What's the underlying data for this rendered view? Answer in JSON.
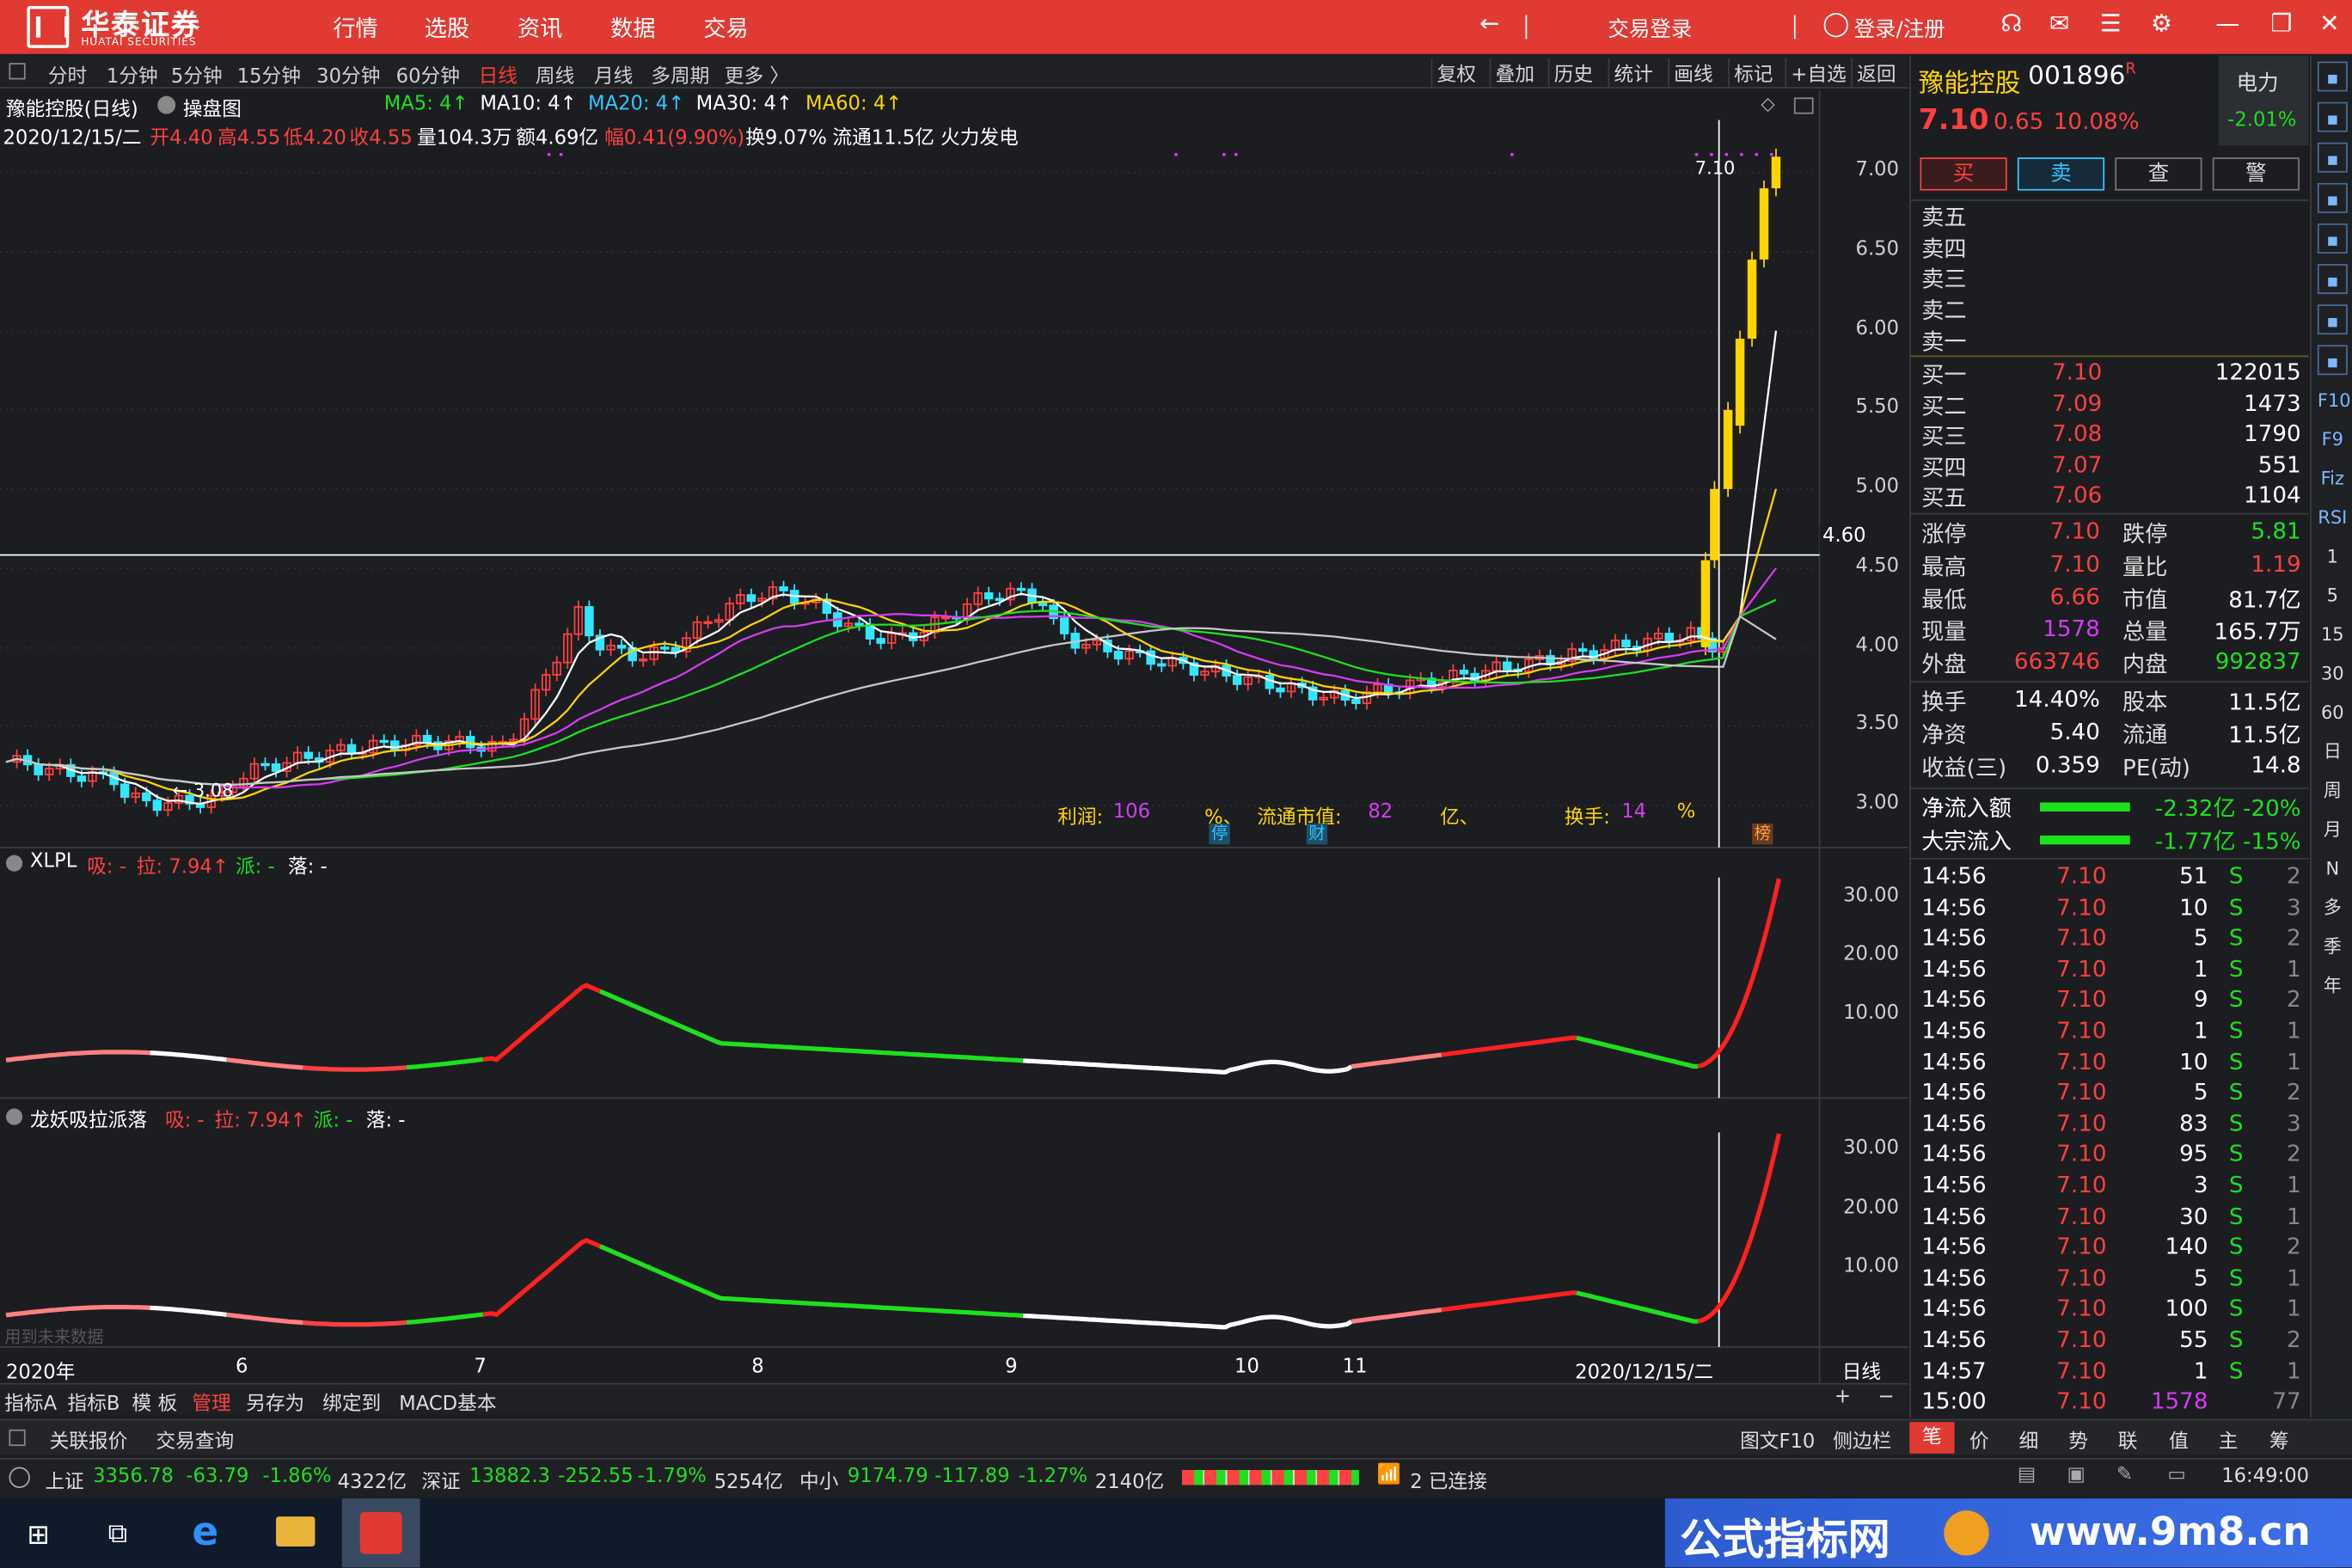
{
  "app": {
    "logo_name": "华泰证券",
    "logo_sub": "HUATAI SECURITIES"
  },
  "topnav": [
    "行情",
    "选股",
    "资讯",
    "数据",
    "交易"
  ],
  "titlebar": {
    "trade_login": "交易登录",
    "login_register": "登录/注册"
  },
  "periods": [
    "分时",
    "1分钟",
    "5分钟",
    "15分钟",
    "30分钟",
    "60分钟",
    "日线",
    "周线",
    "月线",
    "多周期",
    "更多 〉"
  ],
  "right_tools": [
    "复权",
    "叠加",
    "历史",
    "统计",
    "画线",
    "标记",
    "+自选",
    "返回"
  ],
  "stock": {
    "name": "豫能控股",
    "code": "001896",
    "flag": "R",
    "price": "7.10",
    "change": "0.65",
    "pct": "10.08%",
    "sector": "电力",
    "sector_pct": "-2.01%"
  },
  "chart_header": {
    "title": "豫能控股(日线)",
    "mode": "操盘图",
    "ma5": "MA5: 4↑",
    "ma10": "MA10: 4↑",
    "ma20": "MA20: 4↑",
    "ma30": "MA30: 4↑",
    "ma60": "MA60: 4↑"
  },
  "day_info": {
    "date": "2020/12/15/二",
    "open": "开4.40",
    "high": "高4.55",
    "low": "低4.20",
    "close": "收4.55",
    "vol": "量104.3万",
    "amt": "额4.69亿",
    "amp": "幅0.41(9.90%)",
    "turn": "换9.07%",
    "flow": "流通11.5亿",
    "theme": "火力发电"
  },
  "price_axis": [
    "7.00",
    "6.50",
    "6.00",
    "5.50",
    "5.00",
    "4.50",
    "4.00",
    "3.50",
    "3.00"
  ],
  "crosshair": {
    "value": "4.60"
  },
  "annotations": {
    "max_label": "7.10",
    "min_label": "← 3.08",
    "profit": "利润:",
    "profit_val": "106",
    "pct1": "%、",
    "mktcap": "流通市值:",
    "mktcap_val": "82",
    "yi": "亿、",
    "turnover": "换手:",
    "turnover_val": "14",
    "pct2": "%",
    "tag1": "停",
    "tag2": "财",
    "tag3": "榜"
  },
  "ind1": {
    "name": "XLPL",
    "xi": "吸: -",
    "la": "拉: 7.94↑",
    "pai": "派: -",
    "luo": "落: -",
    "axis": [
      "30.00",
      "20.00",
      "10.00"
    ]
  },
  "ind2": {
    "name": "龙妖吸拉派落",
    "xi": "吸: -",
    "la": "拉: 7.94↑",
    "pai": "派: -",
    "luo": "落: -",
    "axis": [
      "30.00",
      "20.00",
      "10.00"
    ],
    "note": "用到未来数据"
  },
  "time_axis": [
    "2020年",
    "6",
    "7",
    "8",
    "9",
    "10",
    "11",
    "2020/12/15/二",
    "日线"
  ],
  "bottom_tabs": [
    "指标A",
    "指标B",
    "模 板",
    "管理",
    "另存为",
    "绑定到",
    "MACD基本"
  ],
  "bottom_tabs2": [
    "关联报价",
    "交易查询"
  ],
  "bottom_right": [
    "图文F10",
    "侧边栏"
  ],
  "trade_buttons": [
    "买",
    "卖",
    "查",
    "警"
  ],
  "sell_rows": [
    "卖五",
    "卖四",
    "卖三",
    "卖二",
    "卖一"
  ],
  "buy_rows": [
    {
      "label": "买一",
      "price": "7.10",
      "vol": "122015"
    },
    {
      "label": "买二",
      "price": "7.09",
      "vol": "1473"
    },
    {
      "label": "买三",
      "price": "7.08",
      "vol": "1790"
    },
    {
      "label": "买四",
      "price": "7.07",
      "vol": "551"
    },
    {
      "label": "买五",
      "price": "7.06",
      "vol": "1104"
    }
  ],
  "stats": [
    {
      "l1": "涨停",
      "v1": "7.10",
      "c1": "red",
      "l2": "跌停",
      "v2": "5.81",
      "c2": "green"
    },
    {
      "l1": "最高",
      "v1": "7.10",
      "c1": "red",
      "l2": "量比",
      "v2": "1.19",
      "c2": "red"
    },
    {
      "l1": "最低",
      "v1": "6.66",
      "c1": "red",
      "l2": "市值",
      "v2": "81.7亿",
      "c2": "white"
    },
    {
      "l1": "现量",
      "v1": "1578",
      "c1": "magenta",
      "l2": "总量",
      "v2": "165.7万",
      "c2": "white"
    },
    {
      "l1": "外盘",
      "v1": "663746",
      "c1": "red",
      "l2": "内盘",
      "v2": "992837",
      "c2": "green"
    }
  ],
  "stats2": [
    {
      "l1": "换手",
      "v1": "14.40%",
      "l2": "股本",
      "v2": "11.5亿"
    },
    {
      "l1": "净资",
      "v1": "5.40",
      "l2": "流通",
      "v2": "11.5亿"
    },
    {
      "l1": "收益(三)",
      "v1": "0.359",
      "l2": "PE(动)",
      "v2": "14.8"
    }
  ],
  "flows": [
    {
      "label": "净流入额",
      "val": "-2.32亿 -20%"
    },
    {
      "label": "大宗流入",
      "val": "-1.77亿 -15%"
    }
  ],
  "ticks": [
    {
      "t": "14:56",
      "p": "7.10",
      "v": "51",
      "s": "S",
      "n": "2"
    },
    {
      "t": "14:56",
      "p": "7.10",
      "v": "10",
      "s": "S",
      "n": "3"
    },
    {
      "t": "14:56",
      "p": "7.10",
      "v": "5",
      "s": "S",
      "n": "2"
    },
    {
      "t": "14:56",
      "p": "7.10",
      "v": "1",
      "s": "S",
      "n": "1"
    },
    {
      "t": "14:56",
      "p": "7.10",
      "v": "9",
      "s": "S",
      "n": "2"
    },
    {
      "t": "14:56",
      "p": "7.10",
      "v": "1",
      "s": "S",
      "n": "1"
    },
    {
      "t": "14:56",
      "p": "7.10",
      "v": "10",
      "s": "S",
      "n": "1"
    },
    {
      "t": "14:56",
      "p": "7.10",
      "v": "5",
      "s": "S",
      "n": "2"
    },
    {
      "t": "14:56",
      "p": "7.10",
      "v": "83",
      "s": "S",
      "n": "3"
    },
    {
      "t": "14:56",
      "p": "7.10",
      "v": "95",
      "s": "S",
      "n": "2"
    },
    {
      "t": "14:56",
      "p": "7.10",
      "v": "3",
      "s": "S",
      "n": "1"
    },
    {
      "t": "14:56",
      "p": "7.10",
      "v": "30",
      "s": "S",
      "n": "1"
    },
    {
      "t": "14:56",
      "p": "7.10",
      "v": "140",
      "s": "S",
      "n": "2"
    },
    {
      "t": "14:56",
      "p": "7.10",
      "v": "5",
      "s": "S",
      "n": "1"
    },
    {
      "t": "14:56",
      "p": "7.10",
      "v": "100",
      "s": "S",
      "n": "1"
    },
    {
      "t": "14:56",
      "p": "7.10",
      "v": "55",
      "s": "S",
      "n": "2"
    },
    {
      "t": "14:57",
      "p": "7.10",
      "v": "1",
      "s": "S",
      "n": "1"
    },
    {
      "t": "15:00",
      "p": "7.10",
      "v": "1578",
      "s": "",
      "n": "77"
    }
  ],
  "panel_tabs": [
    "笔",
    "价",
    "细",
    "势",
    "联",
    "值",
    "主",
    "筹"
  ],
  "right_toolbar_labels": [
    "F10",
    "F9",
    "Fiz",
    "RSI",
    "1",
    "5",
    "15",
    "30",
    "60",
    "日",
    "周",
    "月",
    "N",
    "多",
    "季",
    "年"
  ],
  "status": {
    "sh": "上证",
    "sh_v": "3356.78",
    "sh_c": "-63.79",
    "sh_p": "-1.86%",
    "sh_a": "4322亿",
    "sz": "深证",
    "sz_v": "13882.3",
    "sz_c": "-252.55",
    "sz_p": "-1.79%",
    "sz_a": "5254亿",
    "zx": "中小",
    "zx_v": "9174.79",
    "zx_c": "-117.89",
    "zx_p": "-1.27%",
    "zx_a": "2140亿",
    "conn": "2 已连接",
    "time": "16:49:00"
  },
  "watermark": {
    "text": "公式指标网",
    "url": "www.9m8.cn"
  },
  "colors": {
    "up": "#ff4040",
    "down": "#33e6ff",
    "bg": "#1b1d21",
    "accent": "#e03a32"
  }
}
